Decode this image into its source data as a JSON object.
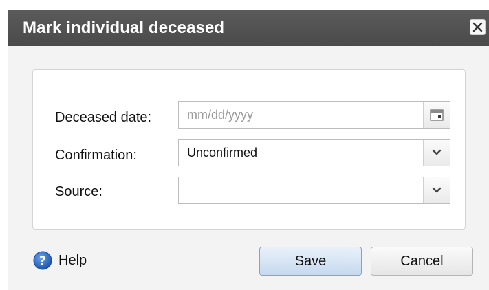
{
  "dialog": {
    "title": "Mark individual deceased"
  },
  "icons": {
    "close": "close-icon",
    "calendar": "calendar-icon",
    "dropdown": "chevron-down-icon",
    "help": "help-icon"
  },
  "form": {
    "deceased_date": {
      "label": "Deceased date:",
      "value": "",
      "placeholder": "mm/dd/yyyy"
    },
    "confirmation": {
      "label": "Confirmation:",
      "value": "Unconfirmed"
    },
    "source": {
      "label": "Source:",
      "value": ""
    }
  },
  "footer": {
    "help_label": "Help",
    "save_label": "Save",
    "cancel_label": "Cancel"
  },
  "colors": {
    "titlebar": "#4f4f4f",
    "save_border": "#7ea4cf",
    "help_icon": "#2f6bc4"
  }
}
